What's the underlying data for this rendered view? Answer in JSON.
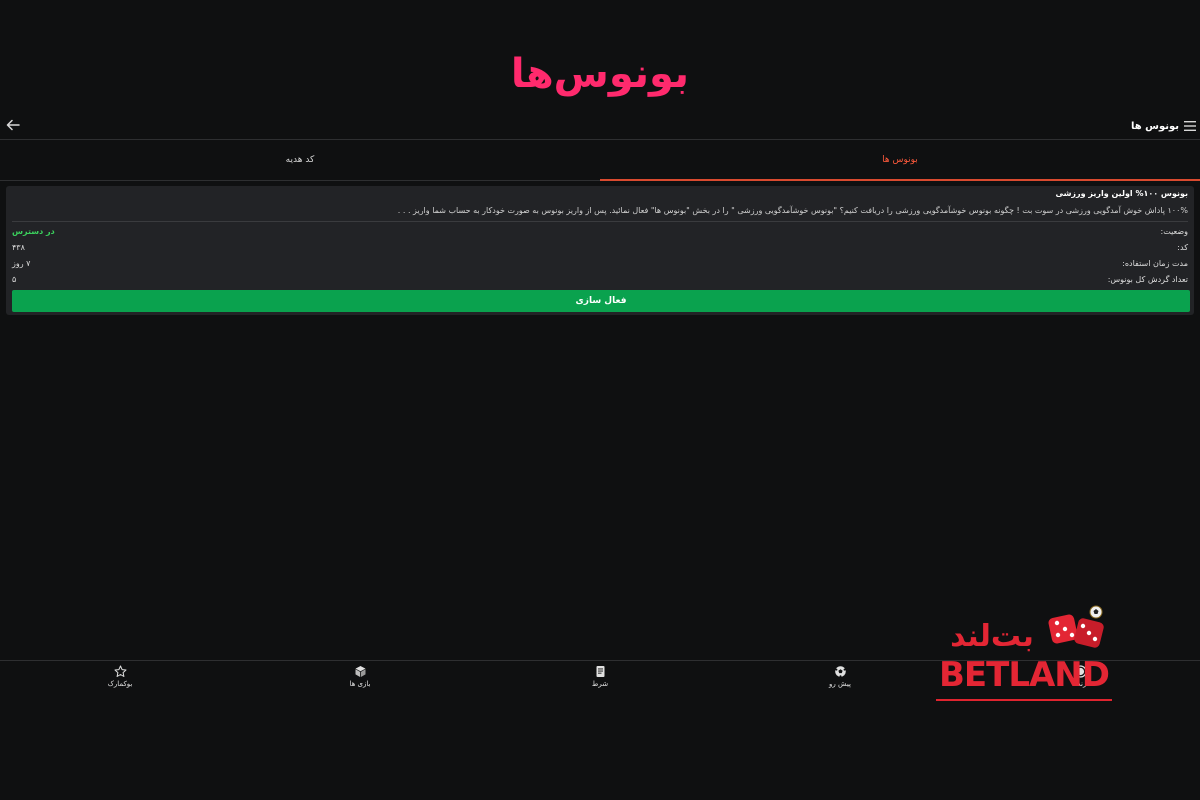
{
  "hero": {
    "title": "بونوس‌ها"
  },
  "topbar": {
    "title": "بونوس ها"
  },
  "tabs": [
    {
      "label": "بونوس ها",
      "active": true
    },
    {
      "label": "کد هدیه",
      "active": false
    }
  ],
  "bonus_card": {
    "title": "بونوس ۱۰۰% اولین واریز ورزشی",
    "description": "۱۰۰% پاداش خوش آمدگویی ورزشی در سوت بت ! چگونه بونوس خوشآمدگویی ورزشی را دریافت کنیم؟ \"بونوس خوشآمدگویی ورزشی \" را در بخش \"بونوس ها\" فعال نمائید. پس از واریز بونوس به صورت خودکار به حساب شما واریز . . .",
    "rows": [
      {
        "label": "وضعیت:",
        "value": "در دسترس",
        "status": "available"
      },
      {
        "label": "کد:",
        "value": "۴۳۸",
        "status": ""
      },
      {
        "label": "مدت زمان استفاده:",
        "value": "۷ روز",
        "status": ""
      },
      {
        "label": "تعداد گردش کل بونوس:",
        "value": "۵",
        "status": ""
      }
    ],
    "activate_label": "فعال سازی"
  },
  "bottom_nav": [
    {
      "label": "زنده",
      "icon": "live-icon"
    },
    {
      "label": "پیش رو",
      "icon": "soccer-ball-icon"
    },
    {
      "label": "شرط",
      "icon": "betslip-icon"
    },
    {
      "label": "بازی ها",
      "icon": "cube-icon"
    },
    {
      "label": "بوکمارک",
      "icon": "star-icon"
    }
  ],
  "brand": {
    "name": "BETLAND",
    "persian_name": "بت‌لند"
  },
  "colors": {
    "background": "#0f1011",
    "accent_pink": "#ff2a6d",
    "active_tab": "#ff5a3c",
    "card": "#222326",
    "button_green": "#0aa24e",
    "status_green": "#3bd05d",
    "brand_red": "#e0242f",
    "brand_gold": "#d8a640"
  }
}
